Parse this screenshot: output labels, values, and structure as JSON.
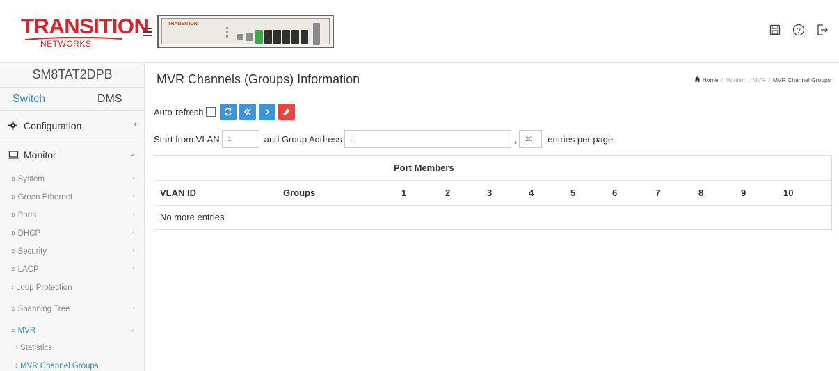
{
  "header": {
    "logo_main": "TRANSITION",
    "logo_sub": "NETWORKS",
    "device_brand": "TRANSITION",
    "icons": [
      "save-icon",
      "help-icon",
      "logout-icon"
    ]
  },
  "sidebar": {
    "model": "SM8TAT2DPB",
    "tabs": [
      "Switch",
      "DMS"
    ],
    "configuration": "Configuration",
    "monitor": "Monitor",
    "items": [
      {
        "label": "» System",
        "chevron": "‹"
      },
      {
        "label": "» Green Ethernet",
        "chevron": "‹"
      },
      {
        "label": "» Ports",
        "chevron": "‹"
      },
      {
        "label": "» DHCP",
        "chevron": "‹"
      },
      {
        "label": "» Security",
        "chevron": "‹"
      },
      {
        "label": "» LACP",
        "chevron": "‹"
      },
      {
        "label": "› Loop Protection",
        "chevron": ""
      },
      {
        "label": "» Spanning Tree",
        "chevron": "‹"
      },
      {
        "label": "» MVR",
        "chevron": "⌄"
      }
    ],
    "mvr_sub": [
      {
        "label": "› Statistics"
      },
      {
        "label": "› MVR Channel Groups"
      }
    ]
  },
  "main": {
    "title": "MVR Channels (Groups) Information",
    "breadcrumb": [
      "Home",
      "Monitor",
      "MVR",
      "MVR Channel Groups"
    ],
    "auto_refresh_label": "Auto-refresh",
    "start_from_vlan_label": "Start from VLAN",
    "start_vlan_value": "1",
    "group_address_label": "and Group Address",
    "group_address_value": "::",
    "comma": ",",
    "entries_value": "20",
    "entries_label": "entries per page.",
    "table": {
      "group_header": "Port Members",
      "columns": [
        "VLAN ID",
        "Groups",
        "1",
        "2",
        "3",
        "4",
        "5",
        "6",
        "7",
        "8",
        "9",
        "10"
      ],
      "empty_message": "No more entries"
    }
  },
  "colors": {
    "accent_blue": "#2e8bcc",
    "button_blue": "#3d94d9",
    "button_red": "#e8463c",
    "brand_red": "#d8232a"
  }
}
